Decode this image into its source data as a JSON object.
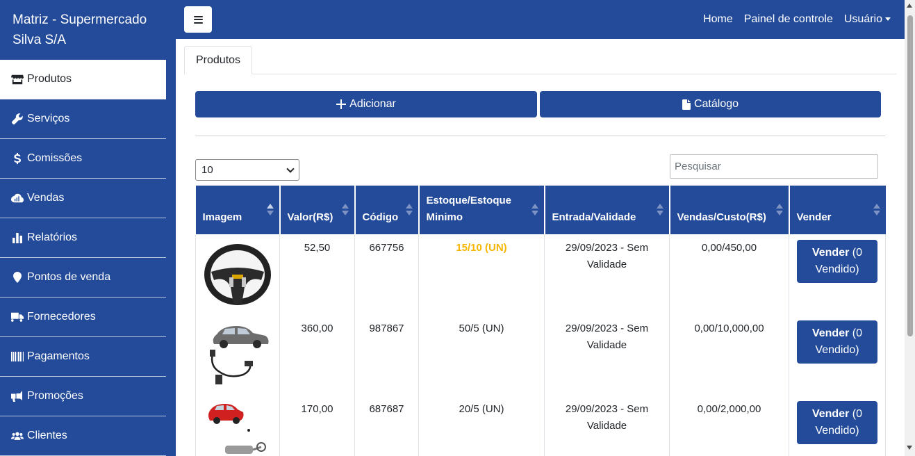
{
  "sidebar": {
    "brand": "Matriz - Supermercado Silva S/A",
    "items": [
      {
        "label": "Produtos",
        "icon": "store-icon"
      },
      {
        "label": "Serviços",
        "icon": "wrench-icon"
      },
      {
        "label": "Comissões",
        "icon": "dollar-icon"
      },
      {
        "label": "Vendas",
        "icon": "cloud-chart-icon"
      },
      {
        "label": "Relatórios",
        "icon": "bar-chart-icon"
      },
      {
        "label": "Pontos de venda",
        "icon": "map-marker-icon"
      },
      {
        "label": "Fornecedores",
        "icon": "truck-icon"
      },
      {
        "label": "Pagamentos",
        "icon": "barcode-icon"
      },
      {
        "label": "Promoções",
        "icon": "megaphone-icon"
      },
      {
        "label": "Clientes",
        "icon": "users-icon"
      }
    ]
  },
  "topbar": {
    "links": {
      "home": "Home",
      "dashboard": "Painel de controle",
      "user": "Usuário"
    }
  },
  "tabs": {
    "active": "Produtos"
  },
  "actions": {
    "add": "Adicionar",
    "catalog": "Catálogo"
  },
  "table_controls": {
    "page_size": "10",
    "search_placeholder": "Pesquisar"
  },
  "table": {
    "headers": {
      "image": "Imagem",
      "value": "Valor(R$)",
      "code": "Código",
      "stock": "Estoque/Estoque Minimo",
      "entry": "Entrada/Validade",
      "sales": "Vendas/Custo(R$)",
      "sell": "Vender"
    },
    "rows": [
      {
        "image": "steering-wheel",
        "value": "52,50",
        "code": "667756",
        "stock": "15/10 (UN)",
        "stock_warning": true,
        "entry": "29/09/2023 - Sem Validade",
        "sales": "0,00/450,00",
        "sell_bold": "Vender",
        "sell_rest": "(0 Vendido)"
      },
      {
        "image": "car-sensor",
        "value": "360,00",
        "code": "987867",
        "stock": "50/5 (UN)",
        "stock_warning": false,
        "entry": "29/09/2023 - Sem Validade",
        "sales": "0,00/10,000,00",
        "sell_bold": "Vender",
        "sell_rest": "(0 Vendido)"
      },
      {
        "image": "car-exhaust",
        "value": "170,00",
        "code": "687687",
        "stock": "20/5 (UN)",
        "stock_warning": false,
        "entry": "29/09/2023 - Sem Validade",
        "sales": "0,00/2,000,00",
        "sell_bold": "Vender",
        "sell_rest": "(0 Vendido)"
      }
    ]
  },
  "colors": {
    "primary": "#234b9a",
    "warning": "#f5b400"
  }
}
